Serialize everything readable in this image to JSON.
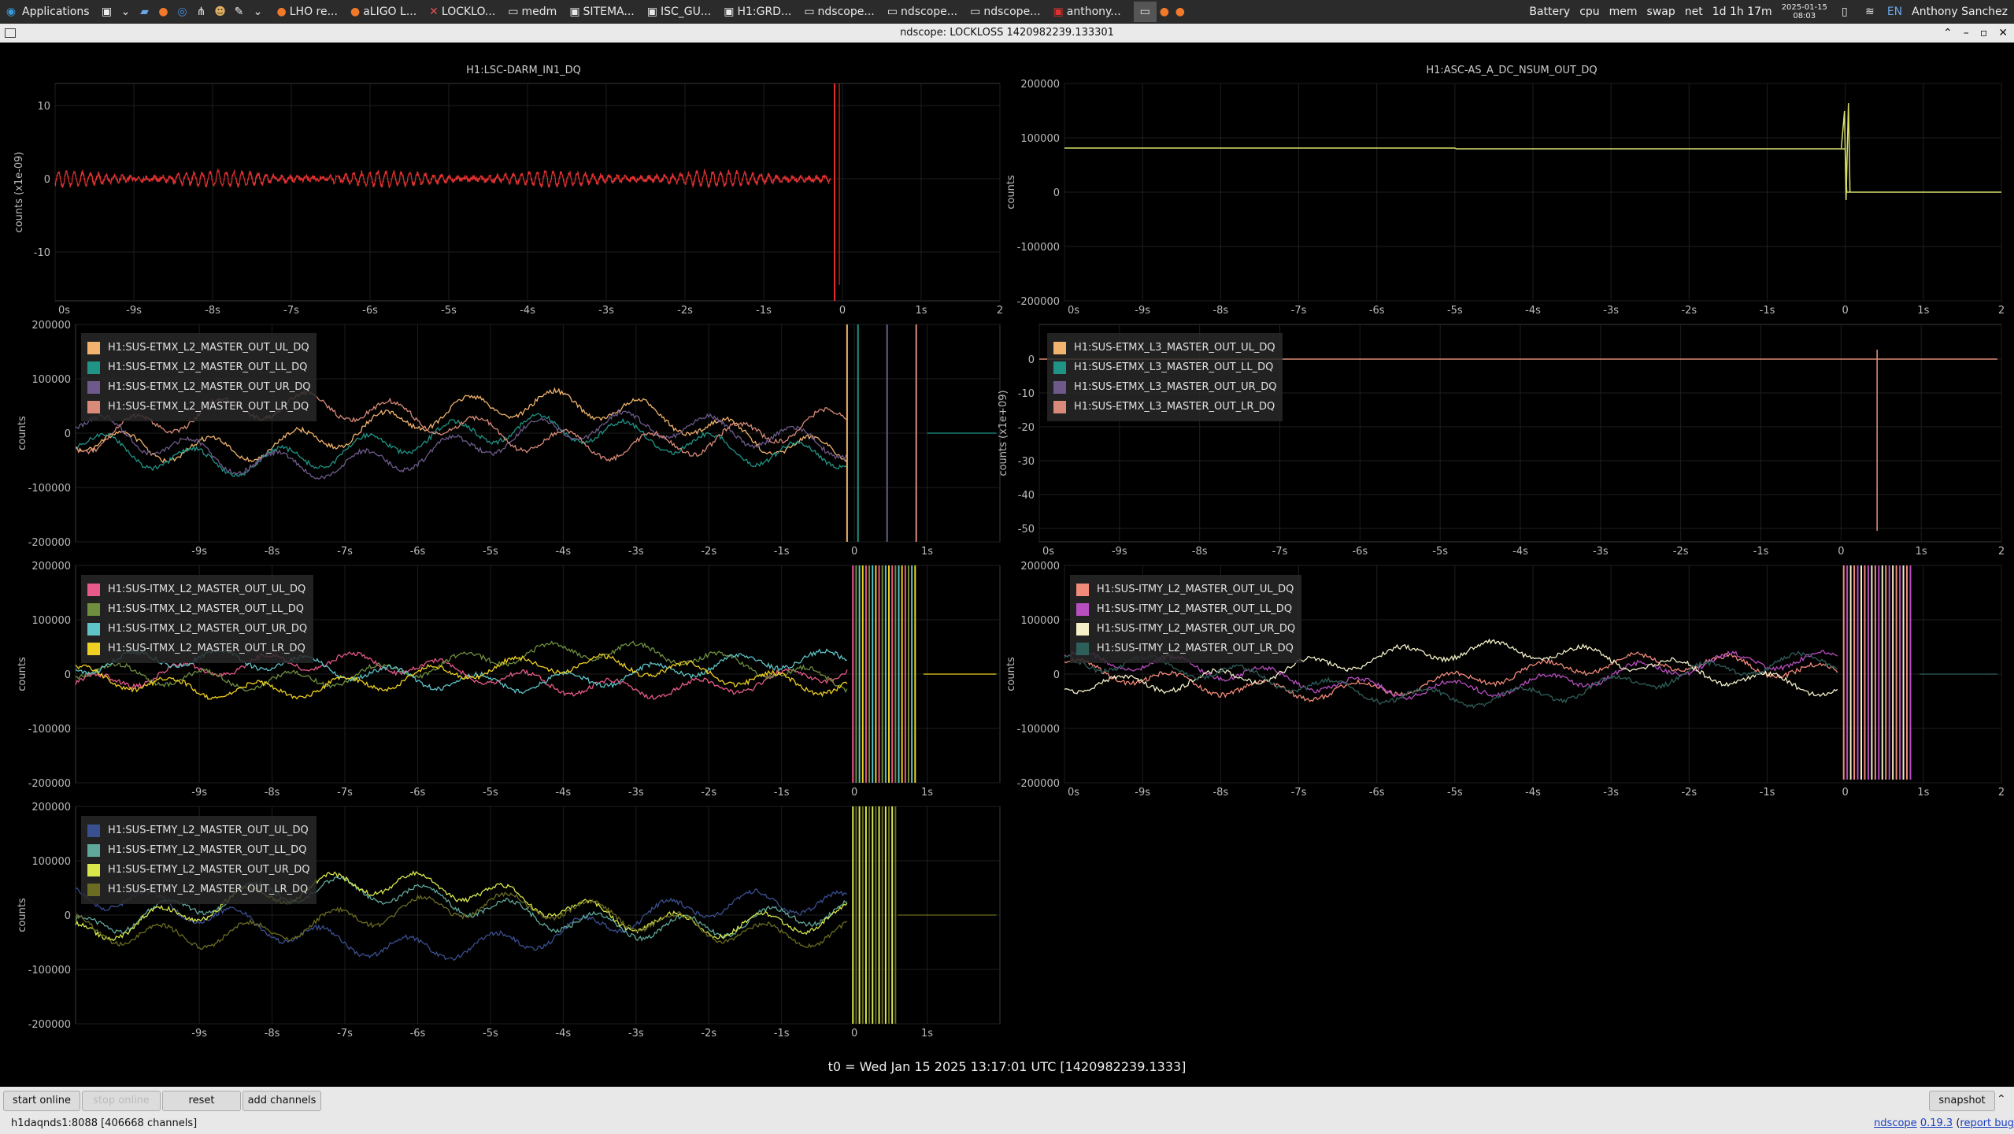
{
  "taskbar": {
    "applications_label": "Applications",
    "windows": [
      "LHO re...",
      "aLIGO L...",
      "LOCKLO...",
      "medm",
      "SITEMA...",
      "ISC_GU...",
      "H1:GRD...",
      "ndscope...",
      "ndscope...",
      "ndscope...",
      "anthony..."
    ],
    "indicators": [
      "Battery",
      "cpu",
      "mem",
      "swap",
      "net",
      "1d 1h 17m"
    ],
    "date": "2025-01-15",
    "time": "08:03",
    "lang": "EN",
    "user": "Anthony Sanchez"
  },
  "window": {
    "title": "ndscope: LOCKLOSS 1420982239.133301"
  },
  "plots": {
    "p1": {
      "title": "H1:LSC-DARM_IN1_DQ",
      "ylabel": "counts (x1e-09)",
      "yticks": [
        "10",
        "0",
        "-10"
      ]
    },
    "p2": {
      "title": "H1:ASC-AS_A_DC_NSUM_OUT_DQ",
      "ylabel": "counts",
      "yticks": [
        "200000",
        "100000",
        "0",
        "-100000",
        "-200000"
      ]
    },
    "p3": {
      "ylabel": "counts",
      "yticks": [
        "200000",
        "100000",
        "0",
        "-100000",
        "-200000"
      ],
      "legend": [
        "H1:SUS-ETMX_L2_MASTER_OUT_UL_DQ",
        "H1:SUS-ETMX_L2_MASTER_OUT_LL_DQ",
        "H1:SUS-ETMX_L2_MASTER_OUT_UR_DQ",
        "H1:SUS-ETMX_L2_MASTER_OUT_LR_DQ"
      ]
    },
    "p4": {
      "ylabel": "counts (x1e+09)",
      "yticks": [
        "0",
        "-10",
        "-20",
        "-30",
        "-40",
        "-50"
      ],
      "legend": [
        "H1:SUS-ETMX_L3_MASTER_OUT_UL_DQ",
        "H1:SUS-ETMX_L3_MASTER_OUT_LL_DQ",
        "H1:SUS-ETMX_L3_MASTER_OUT_UR_DQ",
        "H1:SUS-ETMX_L3_MASTER_OUT_LR_DQ"
      ]
    },
    "p5": {
      "ylabel": "counts",
      "yticks": [
        "200000",
        "100000",
        "0",
        "-100000",
        "-200000"
      ],
      "legend": [
        "H1:SUS-ITMX_L2_MASTER_OUT_UL_DQ",
        "H1:SUS-ITMX_L2_MASTER_OUT_LL_DQ",
        "H1:SUS-ITMX_L2_MASTER_OUT_UR_DQ",
        "H1:SUS-ITMX_L2_MASTER_OUT_LR_DQ"
      ]
    },
    "p6": {
      "ylabel": "counts",
      "yticks": [
        "200000",
        "100000",
        "0",
        "-100000",
        "-200000"
      ],
      "legend": [
        "H1:SUS-ITMY_L2_MASTER_OUT_UL_DQ",
        "H1:SUS-ITMY_L2_MASTER_OUT_LL_DQ",
        "H1:SUS-ITMY_L2_MASTER_OUT_UR_DQ",
        "H1:SUS-ITMY_L2_MASTER_OUT_LR_DQ"
      ]
    },
    "p7": {
      "ylabel": "counts",
      "yticks": [
        "200000",
        "100000",
        "0",
        "-100000",
        "-200000"
      ],
      "legend": [
        "H1:SUS-ETMY_L2_MASTER_OUT_UL_DQ",
        "H1:SUS-ETMY_L2_MASTER_OUT_LL_DQ",
        "H1:SUS-ETMY_L2_MASTER_OUT_UR_DQ",
        "H1:SUS-ETMY_L2_MASTER_OUT_LR_DQ"
      ]
    }
  },
  "xticks": [
    "0s",
    "-9s",
    "-8s",
    "-7s",
    "-6s",
    "-5s",
    "-4s",
    "-3s",
    "-2s",
    "-1s",
    "0",
    "1s",
    "2"
  ],
  "xticks_short": [
    "-9s",
    "-8s",
    "-7s",
    "-6s",
    "-5s",
    "-4s",
    "-3s",
    "-2s",
    "-1s",
    "0",
    "1s"
  ],
  "colors": {
    "darm": "#e03030",
    "asc": "#d8e06a",
    "etmx": [
      "#f2b36e",
      "#1f9486",
      "#6e5a8a",
      "#d98a78"
    ],
    "itmx": [
      "#e85a8a",
      "#6f8f3e",
      "#5fc4c8",
      "#f0d020"
    ],
    "itmy": [
      "#f28a7a",
      "#b84fc0",
      "#f5f0c8",
      "#2f5f5a"
    ],
    "etmy": [
      "#3a4f8f",
      "#5fa89a",
      "#d8e84a",
      "#6b6b22"
    ]
  },
  "t0_label": "t0 = Wed Jan 15 2025 13:17:01 UTC [1420982239.1333]",
  "buttons": {
    "start_online": "start online",
    "stop_online": "stop online",
    "reset": "reset",
    "add_channels": "add channels",
    "snapshot": "snapshot"
  },
  "status": {
    "server": "h1daqnds1:8088  [406668 channels]",
    "app": "ndscope",
    "version": "0.19.3",
    "report": "report bug"
  }
}
